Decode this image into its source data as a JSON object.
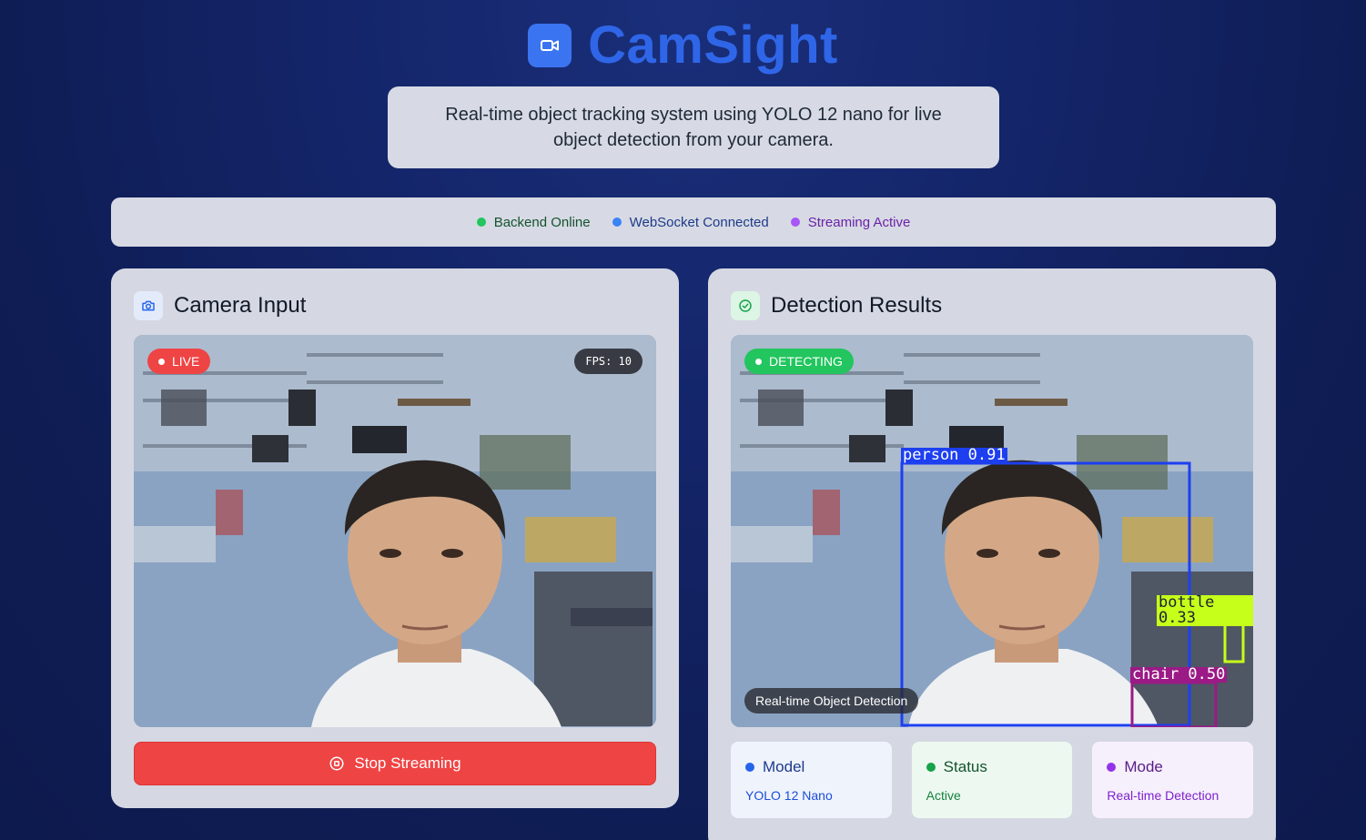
{
  "app": {
    "title": "CamSight",
    "subtitle": "Real-time object tracking system using YOLO 12 nano for live object detection from your camera.",
    "logo_icon": "video-camera-icon"
  },
  "status_bar": {
    "items": [
      {
        "label": "Backend Online",
        "color": "#22c55e",
        "text_color": "#14532d"
      },
      {
        "label": "WebSocket Connected",
        "color": "#3b82f6",
        "text_color": "#1e3a8a"
      },
      {
        "label": "Streaming Active",
        "color": "#a855f7",
        "text_color": "#6b21a8"
      }
    ]
  },
  "camera_panel": {
    "title": "Camera Input",
    "icon": "camera-icon",
    "live_badge": "LIVE",
    "fps_label": "FPS: 10",
    "stop_button": "Stop Streaming",
    "stop_icon": "stop-circle-icon"
  },
  "detection_panel": {
    "title": "Detection Results",
    "icon": "check-circle-icon",
    "status_badge": "DETECTING",
    "caption": "Real-time Object Detection",
    "detections": [
      {
        "label": "person 0.91",
        "color": "#1d3ff0"
      },
      {
        "label": "bottle 0.33",
        "color": "#c6ff1a"
      },
      {
        "label": "chair 0.50",
        "color": "#9b1a86"
      }
    ],
    "info_cards": [
      {
        "title": "Model",
        "value": "YOLO 12 Nano",
        "dot": "#2563eb",
        "title_color": "#1e3a8a",
        "value_color": "#1d4ed8",
        "bg": "#eef3fc"
      },
      {
        "title": "Status",
        "value": "Active",
        "dot": "#16a34a",
        "title_color": "#14532d",
        "value_color": "#15803d",
        "bg": "#edf9f0"
      },
      {
        "title": "Mode",
        "value": "Real-time Detection",
        "dot": "#9333ea",
        "title_color": "#581c87",
        "value_color": "#7e22ce",
        "bg": "#f6f0fc"
      }
    ]
  },
  "colors": {
    "accent": "#2f66e8",
    "live_red": "#ef4444",
    "detecting_green": "#22c55e"
  }
}
